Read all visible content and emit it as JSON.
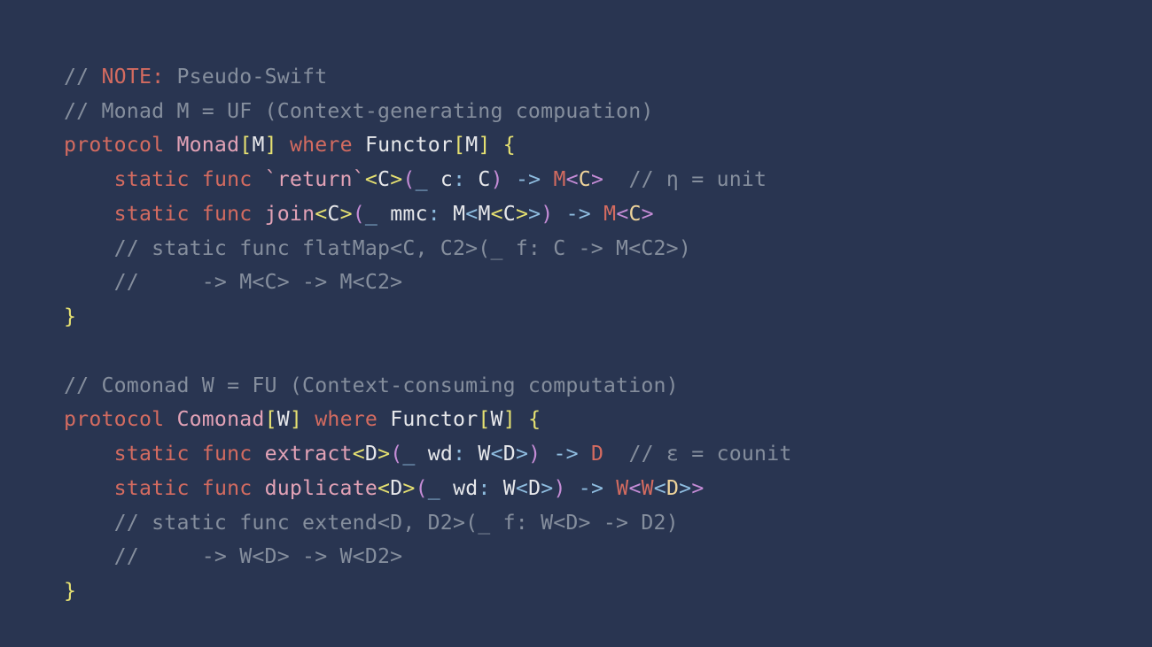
{
  "code": {
    "l01_slashes": "// ",
    "l01_note": "NOTE:",
    "l01_rest": " Pseudo-Swift",
    "l02": "// Monad M = UF (Context-generating compuation)",
    "l03_protocol": "protocol",
    "l03_name": "Monad",
    "l03_lb": "[",
    "l03_M": "M",
    "l03_rb": "]",
    "l03_where": "where",
    "l03_functor": "Functor",
    "l03_lb2": "[",
    "l03_M2": "M",
    "l03_rb2": "]",
    "l03_brace": "{",
    "l04_static": "static",
    "l04_func": "func",
    "l04_name": "`return`",
    "l04_gen_l": "<",
    "l04_gen_C": "C",
    "l04_gen_r": ">",
    "l04_paren_l": "(",
    "l04_us": "_",
    "l04_param": "c",
    "l04_colon": ":",
    "l04_ptype": "C",
    "l04_paren_r": ")",
    "l04_arrow": "->",
    "l04_ret_M": "M",
    "l04_ret_l": "<",
    "l04_ret_C": "C",
    "l04_ret_r": ">",
    "l04_comment": "// η = unit",
    "l05_static": "static",
    "l05_func": "func",
    "l05_name": "join",
    "l05_gen_l": "<",
    "l05_gen_C": "C",
    "l05_gen_r": ">",
    "l05_paren_l": "(",
    "l05_us": "_",
    "l05_param": "mmc",
    "l05_colon": ":",
    "l05_t1": "M",
    "l05_a1l": "<",
    "l05_t2": "M",
    "l05_a2l": "<",
    "l05_t3": "C",
    "l05_a2r": ">",
    "l05_a1r": ">",
    "l05_paren_r": ")",
    "l05_arrow": "->",
    "l05_ret_M": "M",
    "l05_ret_l": "<",
    "l05_ret_C": "C",
    "l05_ret_r": ">",
    "l06": "// static func flatMap<C, C2>(_ f: C -> M<C2>)",
    "l07": "//     -> M<C> -> M<C2>",
    "l08_brace": "}",
    "l10": "// Comonad W = FU (Context-consuming computation)",
    "l11_protocol": "protocol",
    "l11_name": "Comonad",
    "l11_lb": "[",
    "l11_W": "W",
    "l11_rb": "]",
    "l11_where": "where",
    "l11_functor": "Functor",
    "l11_lb2": "[",
    "l11_W2": "W",
    "l11_rb2": "]",
    "l11_brace": "{",
    "l12_static": "static",
    "l12_func": "func",
    "l12_name": "extract",
    "l12_gen_l": "<",
    "l12_gen_D": "D",
    "l12_gen_r": ">",
    "l12_paren_l": "(",
    "l12_us": "_",
    "l12_param": "wd",
    "l12_colon": ":",
    "l12_pt_W": "W",
    "l12_pa_l": "<",
    "l12_pt_D": "D",
    "l12_pa_r": ">",
    "l12_paren_r": ")",
    "l12_arrow": "->",
    "l12_ret": "D",
    "l12_comment": "// ε = counit",
    "l13_static": "static",
    "l13_func": "func",
    "l13_name": "duplicate",
    "l13_gen_l": "<",
    "l13_gen_D": "D",
    "l13_gen_r": ">",
    "l13_paren_l": "(",
    "l13_us": "_",
    "l13_param": "wd",
    "l13_colon": ":",
    "l13_pt_W": "W",
    "l13_pa_l": "<",
    "l13_pt_D": "D",
    "l13_pa_r": ">",
    "l13_paren_r": ")",
    "l13_arrow": "->",
    "l13_r_W1": "W",
    "l13_r_l1": "<",
    "l13_r_W2": "W",
    "l13_r_l2": "<",
    "l13_r_D": "D",
    "l13_r_r2": ">",
    "l13_r_r1": ">",
    "l14": "// static func extend<D, D2>(_ f: W<D> -> D2)",
    "l15": "//     -> W<D> -> W<D2>",
    "l16_brace": "}"
  }
}
